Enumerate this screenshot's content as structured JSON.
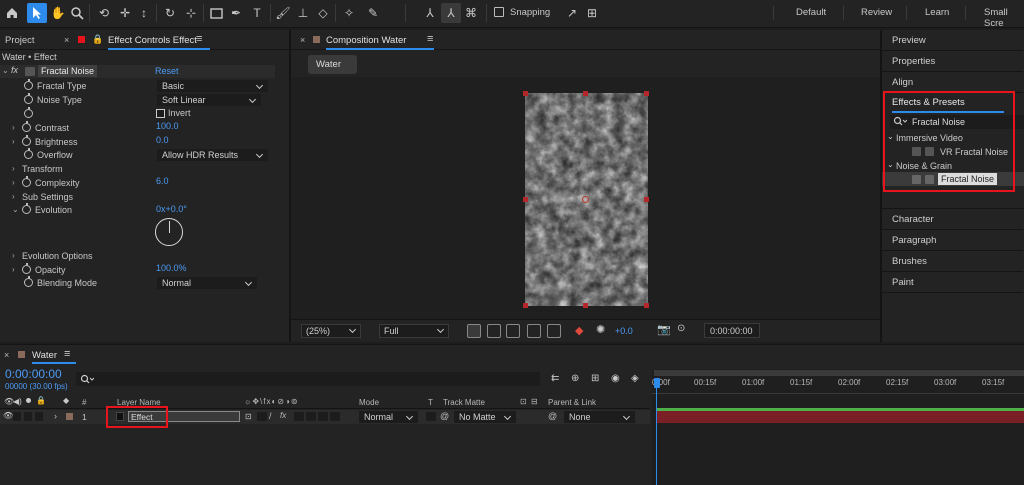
{
  "toolbar": {
    "snapping_label": "Snapping",
    "workspaces": [
      "Default",
      "Review",
      "Learn",
      "Small Scre"
    ]
  },
  "left_panel": {
    "tab_project": "Project",
    "tab_effect_controls": "Effect Controls Effect",
    "breadcrumb": "Water • Effect",
    "effect_name": "Fractal Noise",
    "reset_label": "Reset",
    "properties": {
      "fractal_type": {
        "label": "Fractal Type",
        "value": "Basic"
      },
      "noise_type": {
        "label": "Noise Type",
        "value": "Soft Linear"
      },
      "invert": {
        "label": "Invert"
      },
      "contrast": {
        "label": "Contrast",
        "value": "100.0"
      },
      "brightness": {
        "label": "Brightness",
        "value": "0.0"
      },
      "overflow": {
        "label": "Overflow",
        "value": "Allow HDR Results"
      },
      "transform": {
        "label": "Transform"
      },
      "complexity": {
        "label": "Complexity",
        "value": "6.0"
      },
      "sub_settings": {
        "label": "Sub Settings"
      },
      "evolution": {
        "label": "Evolution",
        "value": "0x+0.0°"
      },
      "evolution_options": {
        "label": "Evolution Options"
      },
      "opacity": {
        "label": "Opacity",
        "value": "100.0%"
      },
      "blending_mode": {
        "label": "Blending Mode",
        "value": "Normal"
      }
    }
  },
  "composition": {
    "tab_label": "Composition Water",
    "comp_button": "Water",
    "zoom": "(25%)",
    "resolution": "Full",
    "exposure": "+0.0",
    "timecode": "0:00:00:00"
  },
  "right_panel": {
    "top_items": [
      "Preview",
      "Properties",
      "Align"
    ],
    "effects_presets_title": "Effects & Presets",
    "search_value": "Fractal Noise",
    "groups": [
      {
        "label": "Immersive Video",
        "items": [
          "VR Fractal Noise"
        ]
      },
      {
        "label": "Noise & Grain",
        "items": [
          "Fractal Noise"
        ]
      }
    ],
    "bottom_items": [
      "Character",
      "Paragraph",
      "Brushes",
      "Paint"
    ]
  },
  "timeline": {
    "tab_label": "Water",
    "timecode": "0:00:00:00",
    "fps": "00000 (30.00 fps)",
    "columns": {
      "hash": "#",
      "layer_name": "Layer Name",
      "mode": "Mode",
      "t": "T",
      "track_matte": "Track Matte",
      "parent_link": "Parent & Link"
    },
    "layer": {
      "index": "1",
      "name": "Effect",
      "mode": "Normal",
      "matte": "No Matte",
      "parent": "None"
    },
    "ruler": [
      "0:00f",
      "00:15f",
      "01:00f",
      "01:15f",
      "02:00f",
      "02:15f",
      "03:00f",
      "03:15f"
    ]
  },
  "colors": {
    "accent": "#4c9bf5",
    "highlight_red": "#e8141c",
    "layer_bar": "#7a1f26"
  }
}
